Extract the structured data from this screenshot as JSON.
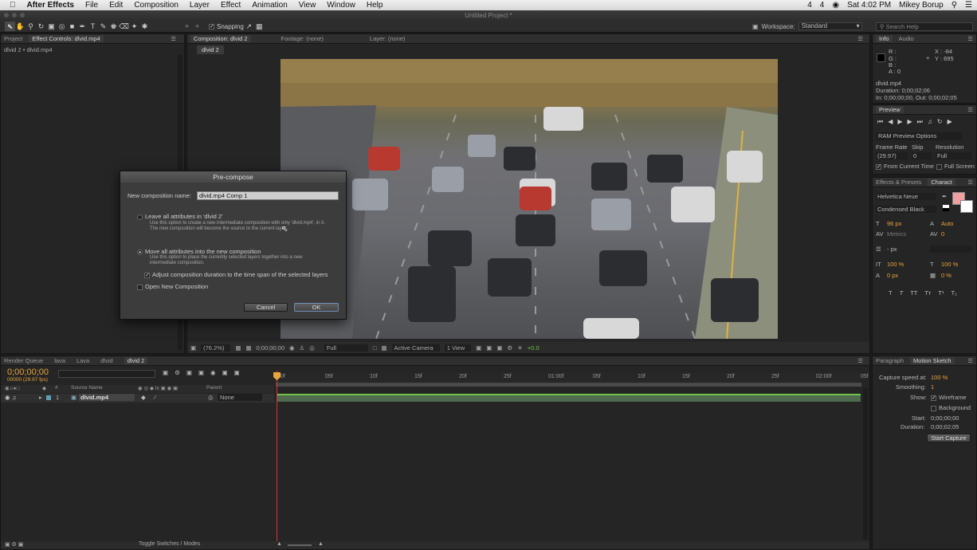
{
  "menubar": {
    "app": "After Effects",
    "items": [
      "File",
      "Edit",
      "Composition",
      "Layer",
      "Effect",
      "Animation",
      "View",
      "Window",
      "Help"
    ],
    "status": [
      "4",
      "4",
      "Sat 4:02 PM",
      "Mikey Borup"
    ]
  },
  "window_title": "Untitled Project *",
  "toolbar": {
    "snapping": "Snapping",
    "workspace_label": "Workspace:",
    "workspace_value": "Standard",
    "search_placeholder": "Search Help"
  },
  "project_panel": {
    "tabs": [
      "Project",
      "Effect Controls: dlvid.mp4"
    ],
    "breadcrumb": "dlvid 2 • dlvid.mp4"
  },
  "composition_panel": {
    "tabs": [
      "Composition: dlvid 2",
      "Footage: (none)",
      "Layer: (none)"
    ],
    "comp_tab": "dlvid 2",
    "footer": {
      "zoom": "(76.2%)",
      "timecode": "0;00;00;00",
      "resolution": "Full",
      "camera": "Active Camera",
      "view": "1 View",
      "exposure": "+0.0"
    }
  },
  "dialog": {
    "title": "Pre-compose",
    "name_label": "New composition name:",
    "name_value": "dlvid.mp4 Comp 1",
    "option1_label": "Leave all attributes in 'dlvid 2'",
    "option1_desc": "Use this option to create a new intermediate composition with only 'dlvid.mp4', in it. The new composition will become the source to the current layer.",
    "option2_label": "Move all attributes into the new composition",
    "option2_desc": "Use this option to place the currently selected layers together into a new intermediate composition.",
    "adjust_label": "Adjust composition duration to the time span of the selected layers",
    "open_label": "Open New Composition",
    "cancel": "Cancel",
    "ok": "OK"
  },
  "info_panel": {
    "tabs": [
      "Info",
      "Audio"
    ],
    "rgba": [
      "R :",
      "G :",
      "B :",
      "A : 0"
    ],
    "x": "X : -84",
    "y": "Y : 695",
    "file": "dlvid.mp4",
    "duration": "Duration: 0;00;02;06",
    "inout": "In: 0;00;00;00, Out: 0;00;02;05"
  },
  "preview_panel": {
    "tab": "Preview",
    "ram_options": "RAM Preview Options",
    "frame_rate_label": "Frame Rate",
    "skip_label": "Skip",
    "resolution_label": "Resolution",
    "frame_rate": "(29.97)",
    "skip": "0",
    "resolution": "Full",
    "from_current": "From Current Time",
    "full_screen": "Full Screen"
  },
  "character_panel": {
    "tabs": [
      "Effects & Presets",
      "Charact"
    ],
    "font": "Helvetica Neue",
    "style": "Condensed Black",
    "size": "96 px",
    "leading": "Auto",
    "tracking_label": "Metrics",
    "tracking": "0",
    "stroke": "- px",
    "vscale": "100 %",
    "hscale": "100 %",
    "baseline": "0 px",
    "tsume": "0 %"
  },
  "timeline": {
    "tabs": [
      "Render Queue",
      "lava",
      "Lava",
      "dlvid",
      "dlvid 2"
    ],
    "timecode": "0;00;00;00",
    "fps": "00000 (29.97 fps)",
    "col_source": "Source Name",
    "col_parent": "Parent",
    "layer_num": "1",
    "layer_name": "dlvid.mp4",
    "layer_parent": "None",
    "ruler": [
      "0f",
      "05f",
      "10f",
      "15f",
      "20f",
      "25f",
      "01:00f",
      "05f",
      "10f",
      "15f",
      "20f",
      "25f",
      "02:00f",
      "05f"
    ],
    "toggle": "Toggle Switches / Modes"
  },
  "motion_sketch": {
    "tabs": [
      "Paragraph",
      "Motion Sketch"
    ],
    "capture_speed_label": "Capture speed at:",
    "capture_speed": "100 %",
    "smoothing_label": "Smoothing:",
    "smoothing": "1",
    "show_label": "Show:",
    "wireframe": "Wireframe",
    "background": "Background",
    "start_label": "Start:",
    "start": "0;00;00;00",
    "duration_label": "Duration:",
    "duration": "0;00;02;05",
    "capture_button": "Start Capture"
  }
}
